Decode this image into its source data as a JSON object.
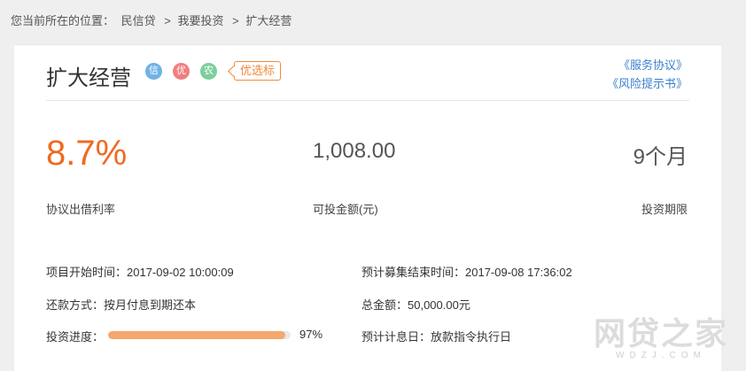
{
  "breadcrumb": {
    "prefix": "您当前所在的位置：",
    "items": [
      "民信贷",
      "我要投资",
      "扩大经营"
    ],
    "separator": ">"
  },
  "product": {
    "title": "扩大经营",
    "badges": [
      "信",
      "优",
      "农"
    ],
    "tag": "优选标",
    "links": [
      "《服务协议》",
      "《风险提示书》"
    ]
  },
  "metrics": {
    "rate_value": "8.7%",
    "rate_label": "协议出借利率",
    "amount_value": "1,008.00",
    "amount_label": "可投金额(元)",
    "term_value": "9个月",
    "term_label": "投资期限"
  },
  "details": {
    "start_time": "项目开始时间：2017-09-02 10:00:09",
    "end_time": "预计募集结束时间：2017-09-08 17:36:02",
    "repayment": "还款方式：按月付息到期还本",
    "total": "总金额：50,000.00元",
    "progress_label": "投资进度：",
    "progress_pct": "97%",
    "progress_value": 97,
    "interest_date": "预计计息日：放款指令执行日"
  },
  "watermark": {
    "main": "网贷之家",
    "sub": "WDZJ.COM"
  },
  "colors": {
    "accent": "#f06a1f",
    "link": "#3a7fcf",
    "progress": "#f5a76d"
  }
}
